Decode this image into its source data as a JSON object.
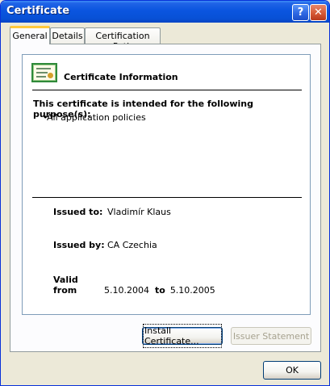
{
  "window": {
    "title": "Certificate"
  },
  "titlebar": {
    "help_glyph": "?",
    "close_glyph": "✕"
  },
  "tabs": [
    {
      "label": "General",
      "active": true
    },
    {
      "label": "Details",
      "active": false
    },
    {
      "label": "Certification Path",
      "active": false
    }
  ],
  "general": {
    "heading": "Certificate Information",
    "purpose_title": "This certificate is intended for the following purpose(s):",
    "purpose_bullet": "•",
    "purposes": [
      "All application policies"
    ],
    "issued_to_label": "Issued to:",
    "issued_to": "Vladimír Klaus",
    "issued_by_label": "Issued by:",
    "issued_by": "CA Czechia",
    "valid_from_label": "Valid from",
    "valid_from": "5.10.2004",
    "valid_to_label": "to",
    "valid_to": "5.10.2005"
  },
  "buttons": {
    "install": "Install Certificate...",
    "issuer": "Issuer Statement",
    "ok": "OK"
  },
  "icons": {
    "certificate": "certificate-icon",
    "help": "help-icon",
    "close": "close-icon"
  },
  "colors": {
    "titlebar": "#0a55df",
    "active_tab_accent": "#ffc83c",
    "dialog_bg": "#ece9d8"
  }
}
